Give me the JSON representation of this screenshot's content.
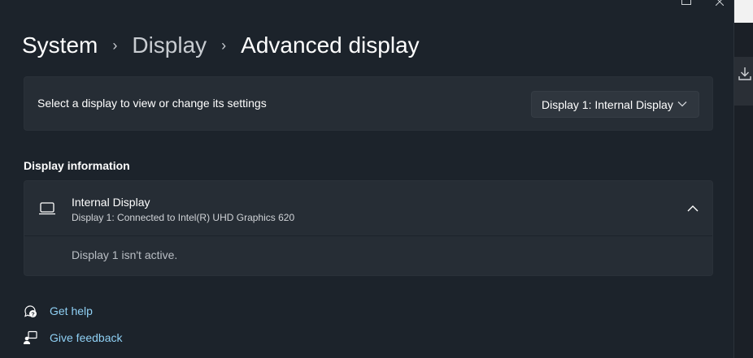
{
  "breadcrumb": {
    "items": [
      "System",
      "Display",
      "Advanced display"
    ],
    "separator": "›"
  },
  "display_selector": {
    "label": "Select a display to view or change its settings",
    "selected": "Display 1: Internal Display"
  },
  "display_information": {
    "header": "Display information",
    "display_name": "Internal Display",
    "display_detail": "Display 1: Connected to Intel(R) UHD Graphics 620",
    "status_text": "Display 1 isn't active."
  },
  "links": {
    "help": "Get help",
    "feedback": "Give feedback"
  },
  "colors": {
    "background": "#1c232b",
    "card": "#262d35",
    "link": "#8fd0f4"
  },
  "icons": [
    "chevron-right-icon",
    "chevron-down-icon",
    "laptop-icon",
    "chevron-up-icon",
    "help-icon",
    "feedback-icon",
    "download-icon"
  ]
}
